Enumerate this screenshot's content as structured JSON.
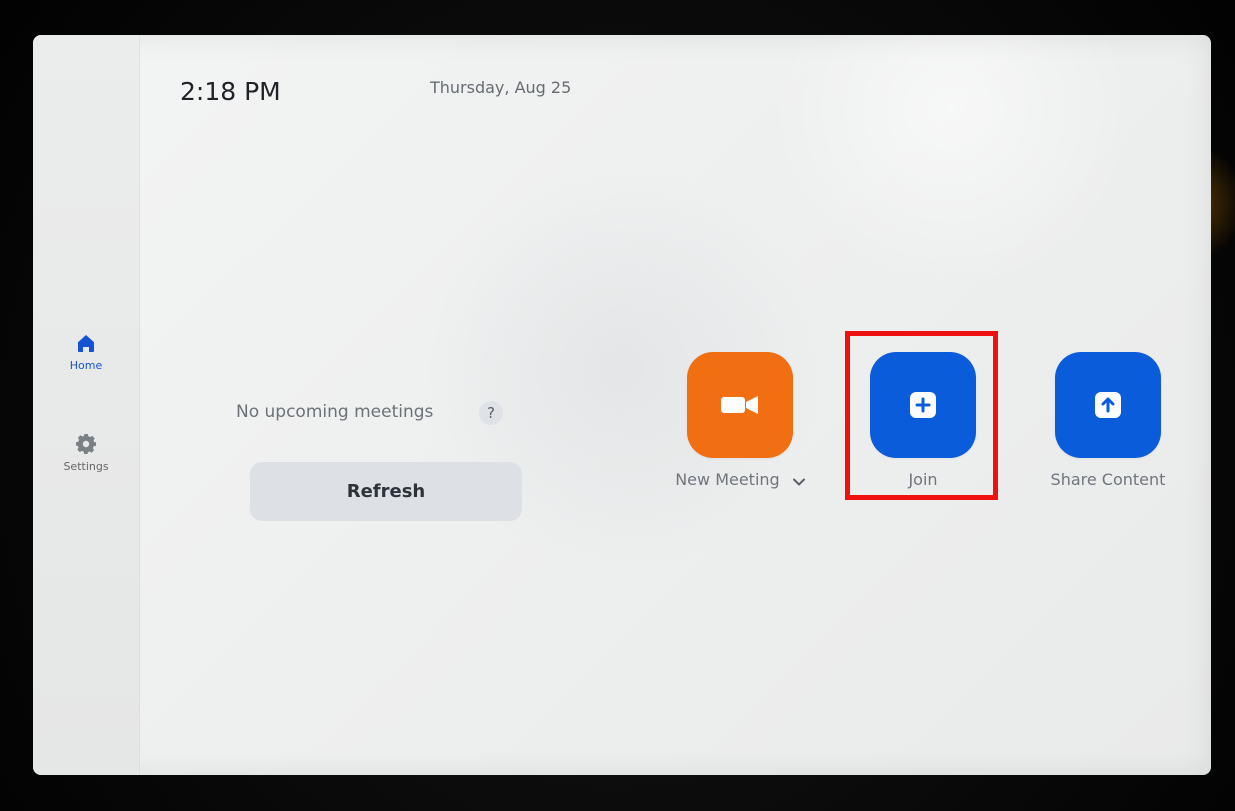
{
  "header": {
    "time": "2:18 PM",
    "date": "Thursday, Aug 25"
  },
  "sidebar": {
    "items": [
      {
        "label": "Home",
        "icon": "home-icon",
        "color": "#1553d4"
      },
      {
        "label": "Settings",
        "icon": "gear-icon",
        "color": "#7b8085"
      }
    ]
  },
  "main": {
    "status": "No upcoming meetings",
    "help": "?",
    "refresh_label": "Refresh"
  },
  "actions": [
    {
      "label": "New Meeting",
      "icon": "video-camera-icon",
      "color": "#f16f12",
      "has_dropdown": true
    },
    {
      "label": "Join",
      "icon": "plus-square-icon",
      "color": "#0b5cdb"
    },
    {
      "label": "Share Content",
      "icon": "upload-arrow-icon",
      "color": "#0b5cdb"
    }
  ],
  "highlight": {
    "target": "Join",
    "color": "#ef1111"
  }
}
